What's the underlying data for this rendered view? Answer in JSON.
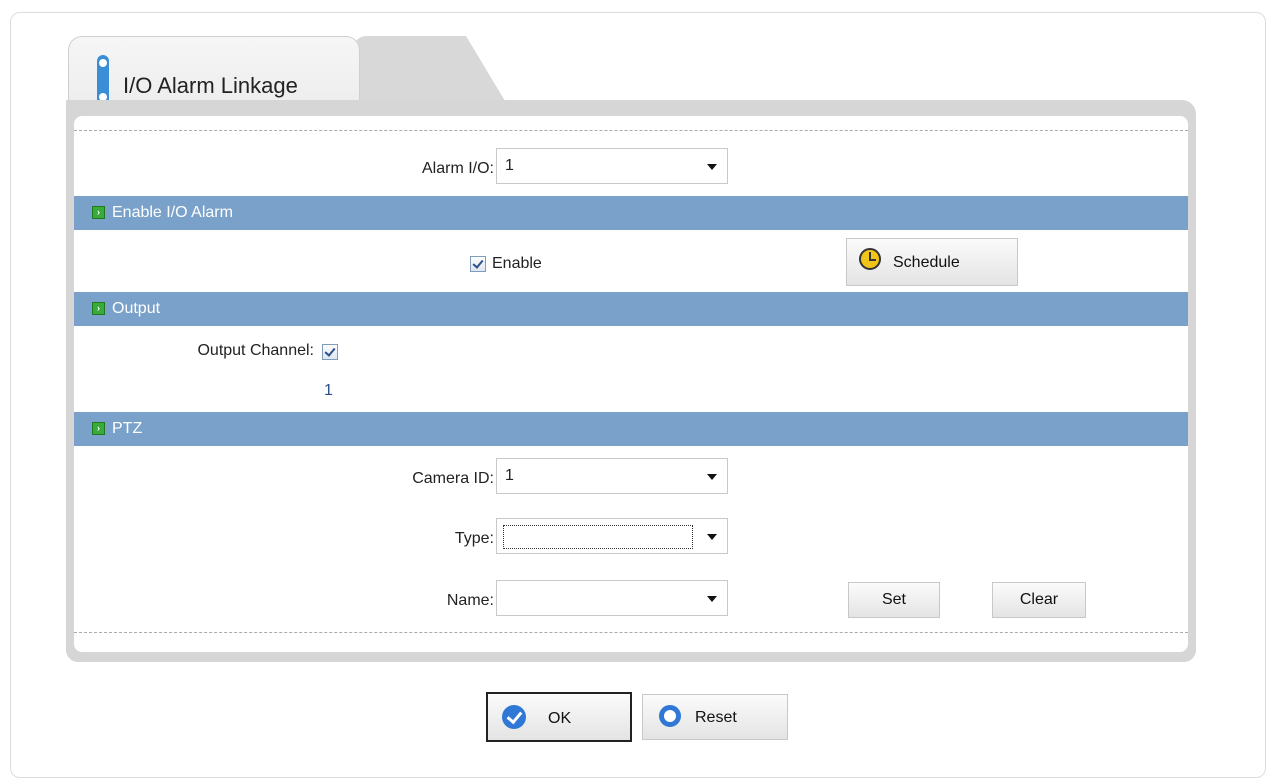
{
  "page": {
    "tab_title": "I/O Alarm Linkage"
  },
  "alarm_io": {
    "label": "Alarm I/O:",
    "value": "1"
  },
  "sections": {
    "enable": "Enable I/O Alarm",
    "output": "Output",
    "ptz": "PTZ"
  },
  "enable": {
    "checkbox_label": "Enable",
    "checked": true,
    "schedule_label": "Schedule"
  },
  "output": {
    "channel_label": "Output Channel:",
    "checked": true,
    "channel_number": "1"
  },
  "ptz": {
    "camera_label": "Camera ID:",
    "camera_value": "1",
    "type_label": "Type:",
    "type_value": "",
    "name_label": "Name:",
    "name_value": "",
    "set_label": "Set",
    "clear_label": "Clear"
  },
  "footer": {
    "ok_label": "OK",
    "reset_label": "Reset"
  },
  "colors": {
    "section_bar": "#7aa1c9",
    "accent": "#2f78d6"
  },
  "icons": [
    "io-alarm-icon",
    "section-arrow-icon",
    "clock-icon",
    "ok-check-icon",
    "reset-icon"
  ]
}
